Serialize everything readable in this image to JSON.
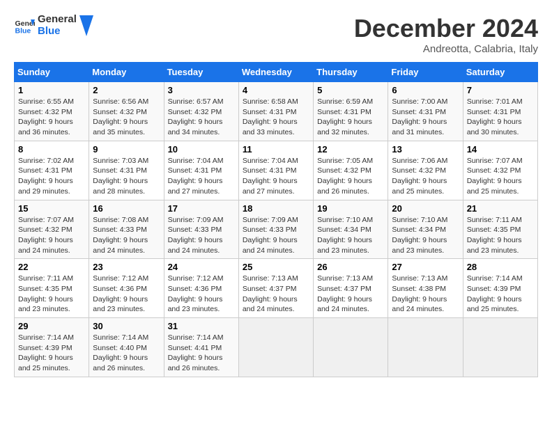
{
  "header": {
    "logo_text_general": "General",
    "logo_text_blue": "Blue",
    "title": "December 2024",
    "subtitle": "Andreotta, Calabria, Italy"
  },
  "calendar": {
    "days_of_week": [
      "Sunday",
      "Monday",
      "Tuesday",
      "Wednesday",
      "Thursday",
      "Friday",
      "Saturday"
    ],
    "weeks": [
      [
        {
          "day": "1",
          "info": "Sunrise: 6:55 AM\nSunset: 4:32 PM\nDaylight: 9 hours\nand 36 minutes."
        },
        {
          "day": "2",
          "info": "Sunrise: 6:56 AM\nSunset: 4:32 PM\nDaylight: 9 hours\nand 35 minutes."
        },
        {
          "day": "3",
          "info": "Sunrise: 6:57 AM\nSunset: 4:32 PM\nDaylight: 9 hours\nand 34 minutes."
        },
        {
          "day": "4",
          "info": "Sunrise: 6:58 AM\nSunset: 4:31 PM\nDaylight: 9 hours\nand 33 minutes."
        },
        {
          "day": "5",
          "info": "Sunrise: 6:59 AM\nSunset: 4:31 PM\nDaylight: 9 hours\nand 32 minutes."
        },
        {
          "day": "6",
          "info": "Sunrise: 7:00 AM\nSunset: 4:31 PM\nDaylight: 9 hours\nand 31 minutes."
        },
        {
          "day": "7",
          "info": "Sunrise: 7:01 AM\nSunset: 4:31 PM\nDaylight: 9 hours\nand 30 minutes."
        }
      ],
      [
        {
          "day": "8",
          "info": "Sunrise: 7:02 AM\nSunset: 4:31 PM\nDaylight: 9 hours\nand 29 minutes."
        },
        {
          "day": "9",
          "info": "Sunrise: 7:03 AM\nSunset: 4:31 PM\nDaylight: 9 hours\nand 28 minutes."
        },
        {
          "day": "10",
          "info": "Sunrise: 7:04 AM\nSunset: 4:31 PM\nDaylight: 9 hours\nand 27 minutes."
        },
        {
          "day": "11",
          "info": "Sunrise: 7:04 AM\nSunset: 4:31 PM\nDaylight: 9 hours\nand 27 minutes."
        },
        {
          "day": "12",
          "info": "Sunrise: 7:05 AM\nSunset: 4:32 PM\nDaylight: 9 hours\nand 26 minutes."
        },
        {
          "day": "13",
          "info": "Sunrise: 7:06 AM\nSunset: 4:32 PM\nDaylight: 9 hours\nand 25 minutes."
        },
        {
          "day": "14",
          "info": "Sunrise: 7:07 AM\nSunset: 4:32 PM\nDaylight: 9 hours\nand 25 minutes."
        }
      ],
      [
        {
          "day": "15",
          "info": "Sunrise: 7:07 AM\nSunset: 4:32 PM\nDaylight: 9 hours\nand 24 minutes."
        },
        {
          "day": "16",
          "info": "Sunrise: 7:08 AM\nSunset: 4:33 PM\nDaylight: 9 hours\nand 24 minutes."
        },
        {
          "day": "17",
          "info": "Sunrise: 7:09 AM\nSunset: 4:33 PM\nDaylight: 9 hours\nand 24 minutes."
        },
        {
          "day": "18",
          "info": "Sunrise: 7:09 AM\nSunset: 4:33 PM\nDaylight: 9 hours\nand 24 minutes."
        },
        {
          "day": "19",
          "info": "Sunrise: 7:10 AM\nSunset: 4:34 PM\nDaylight: 9 hours\nand 23 minutes."
        },
        {
          "day": "20",
          "info": "Sunrise: 7:10 AM\nSunset: 4:34 PM\nDaylight: 9 hours\nand 23 minutes."
        },
        {
          "day": "21",
          "info": "Sunrise: 7:11 AM\nSunset: 4:35 PM\nDaylight: 9 hours\nand 23 minutes."
        }
      ],
      [
        {
          "day": "22",
          "info": "Sunrise: 7:11 AM\nSunset: 4:35 PM\nDaylight: 9 hours\nand 23 minutes."
        },
        {
          "day": "23",
          "info": "Sunrise: 7:12 AM\nSunset: 4:36 PM\nDaylight: 9 hours\nand 23 minutes."
        },
        {
          "day": "24",
          "info": "Sunrise: 7:12 AM\nSunset: 4:36 PM\nDaylight: 9 hours\nand 23 minutes."
        },
        {
          "day": "25",
          "info": "Sunrise: 7:13 AM\nSunset: 4:37 PM\nDaylight: 9 hours\nand 24 minutes."
        },
        {
          "day": "26",
          "info": "Sunrise: 7:13 AM\nSunset: 4:37 PM\nDaylight: 9 hours\nand 24 minutes."
        },
        {
          "day": "27",
          "info": "Sunrise: 7:13 AM\nSunset: 4:38 PM\nDaylight: 9 hours\nand 24 minutes."
        },
        {
          "day": "28",
          "info": "Sunrise: 7:14 AM\nSunset: 4:39 PM\nDaylight: 9 hours\nand 25 minutes."
        }
      ],
      [
        {
          "day": "29",
          "info": "Sunrise: 7:14 AM\nSunset: 4:39 PM\nDaylight: 9 hours\nand 25 minutes."
        },
        {
          "day": "30",
          "info": "Sunrise: 7:14 AM\nSunset: 4:40 PM\nDaylight: 9 hours\nand 26 minutes."
        },
        {
          "day": "31",
          "info": "Sunrise: 7:14 AM\nSunset: 4:41 PM\nDaylight: 9 hours\nand 26 minutes."
        },
        {
          "day": "",
          "info": ""
        },
        {
          "day": "",
          "info": ""
        },
        {
          "day": "",
          "info": ""
        },
        {
          "day": "",
          "info": ""
        }
      ]
    ]
  }
}
